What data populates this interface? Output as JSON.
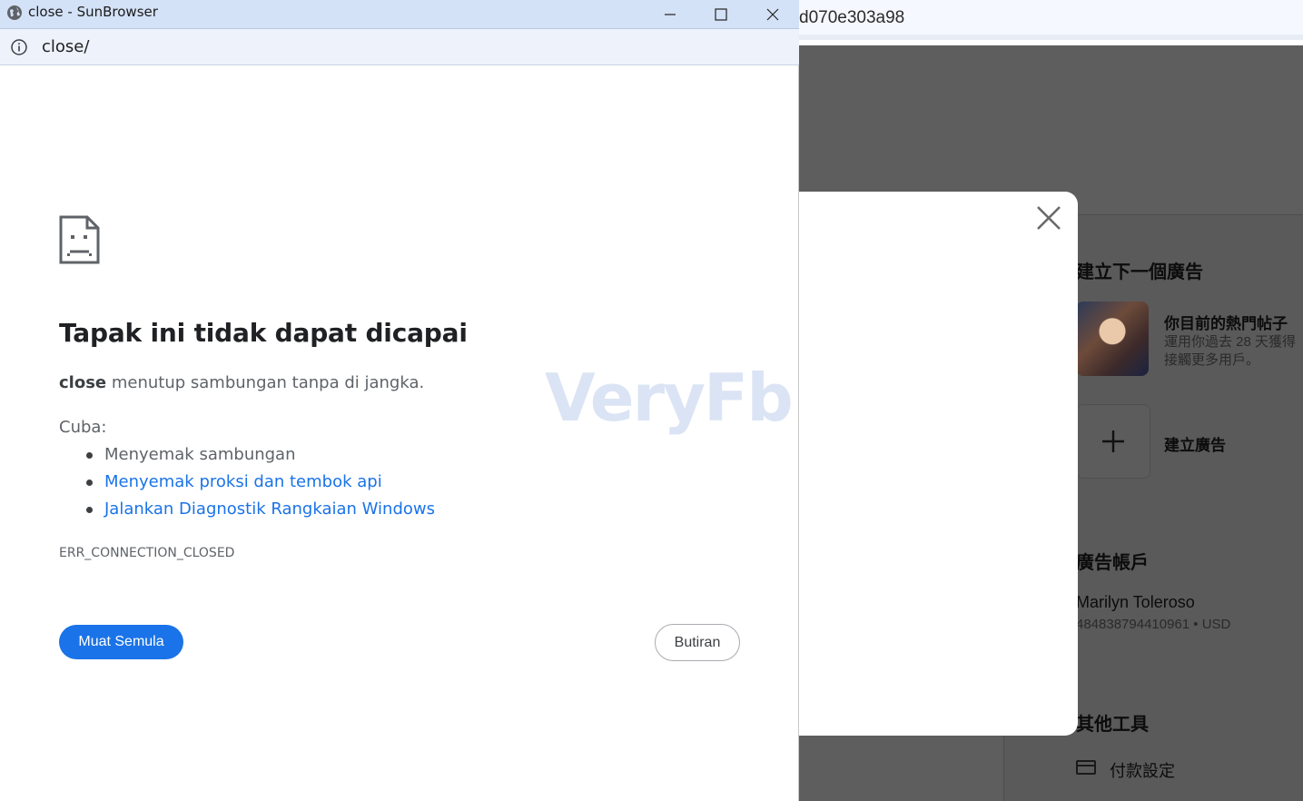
{
  "background_page": {
    "url_fragment": "d070e303a98",
    "next_ad_heading": "建立下一個廣告",
    "hot_post_title": "你目前的熱門帖子",
    "hot_post_desc_line1": "運用你過去 28 天獲得",
    "hot_post_desc_line2": "接觸更多用戶。",
    "create_ad_label": "建立廣告",
    "ad_account_heading": "廣告帳戶",
    "account_name": "Marilyn Toleroso",
    "account_meta": "484838794410961 • USD",
    "other_tools_heading": "其他工具",
    "payment_settings_label": "付款設定"
  },
  "popup_window": {
    "title": "close - SunBrowser",
    "address": "close/"
  },
  "error_page": {
    "title": "Tapak ini tidak dapat dicapai",
    "host": "close",
    "description": " menutup sambungan tanpa di jangka.",
    "try_label": "Cuba:",
    "suggestions": [
      {
        "text": "Menyemak sambungan",
        "link": false
      },
      {
        "text": "Menyemak proksi dan tembok api",
        "link": true
      },
      {
        "text": "Jalankan Diagnostik Rangkaian Windows",
        "link": true
      }
    ],
    "error_code": "ERR_CONNECTION_CLOSED",
    "reload_label": "Muat Semula",
    "details_label": "Butiran"
  },
  "watermark": "VeryFb",
  "colors": {
    "accent_blue": "#1a73e8",
    "titlebar": "#d4e2f7",
    "overlay_gray": "#5e5e5e"
  }
}
